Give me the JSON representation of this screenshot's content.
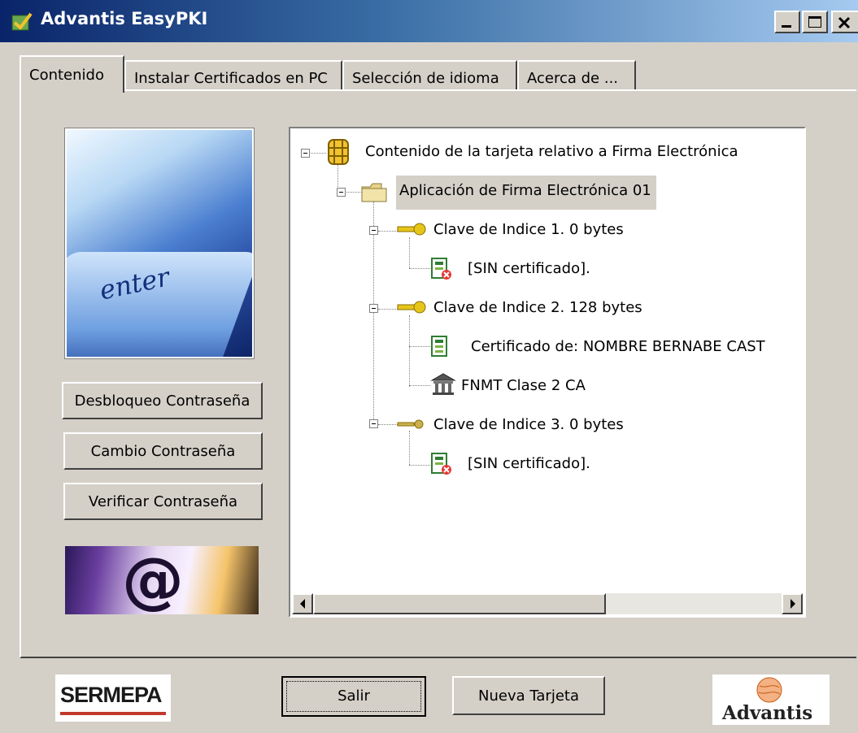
{
  "window": {
    "title": "Advantis EasyPKI",
    "controls": [
      "minimize",
      "maximize",
      "close"
    ]
  },
  "tabs": [
    {
      "label": "Contenido",
      "active": true
    },
    {
      "label": "Instalar Certificados en PC",
      "active": false
    },
    {
      "label": "Selección de idioma",
      "active": false
    },
    {
      "label": "Acerca de ...",
      "active": false
    }
  ],
  "left_panel": {
    "photo_key_text": "enter",
    "buttons": {
      "unlock": "Desbloqueo Contraseña",
      "change": "Cambio Contraseña",
      "verify": "Verificar Contraseña"
    },
    "banner_symbol": "@"
  },
  "tree": {
    "root": "Contenido de la tarjeta relativo a Firma Electrónica",
    "app": "Aplicación de Firma Electrónica 01",
    "key1": "Clave de Indice 1. 0 bytes",
    "key1_cert": "[SIN certificado].",
    "key2": "Clave de Indice 2. 128 bytes",
    "key2_cert": "Certificado de: NOMBRE BERNABE CAST",
    "key2_ca": "FNMT Clase 2 CA",
    "key3": "Clave de Indice 3. 0 bytes",
    "key3_cert": "[SIN certificado]."
  },
  "footer": {
    "exit": "Salir",
    "new_card": "Nueva Tarjeta",
    "sermepa_logo": "SERMEPA",
    "advantis_logo": "Advantis"
  },
  "colors": {
    "window_bg": "#d4d0c8",
    "titlebar_start": "#0a246a",
    "titlebar_end": "#a6caf0",
    "selection_bg": "#d4d0c8"
  },
  "icons": {
    "chip": "smartcard-chip-icon",
    "folder": "folder-icon",
    "key": "key-icon",
    "cert_missing": "certificate-missing-icon",
    "cert": "certificate-icon",
    "ca": "certificate-authority-icon"
  }
}
